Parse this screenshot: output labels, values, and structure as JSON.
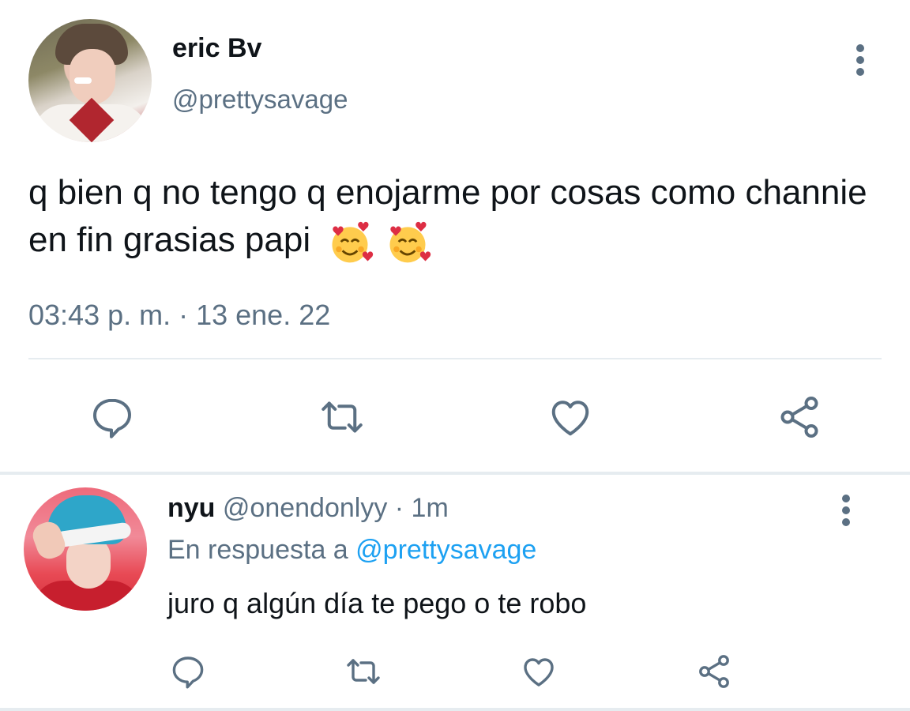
{
  "main_tweet": {
    "display_name": "eric Bv",
    "handle": "@prettysavage",
    "text": "q bien q no tengo q enojarme por cosas como channie en fin grasias papi",
    "emoji": "🥰🥰",
    "timestamp": "03:43 p. m. · 13 ene. 22",
    "avatar_icon": "user-avatar-photo",
    "actions": [
      "reply-icon",
      "retweet-icon",
      "like-icon",
      "share-icon"
    ]
  },
  "reply": {
    "display_name": "nyu",
    "handle_time": "@onendonlyy · 1m",
    "in_reply_prefix": "En respuesta a",
    "in_reply_handle": "@prettysavage",
    "text": "juro q algún día te pego o te robo",
    "avatar_icon": "user-avatar-photo",
    "actions": [
      "reply-icon",
      "retweet-icon",
      "like-icon",
      "share-icon"
    ]
  },
  "colors": {
    "primary_text": "#0f1419",
    "secondary_text": "#5b7083",
    "link": "#1da1f2",
    "divider": "#e6ecf0"
  }
}
